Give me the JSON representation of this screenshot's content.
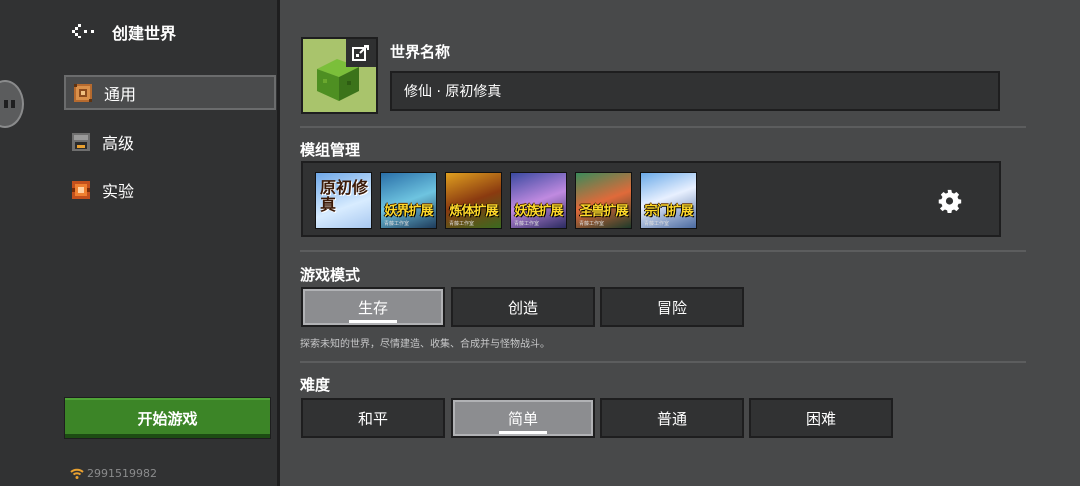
{
  "header": {
    "title": "创建世界"
  },
  "sidebar": {
    "items": [
      {
        "label": "通用",
        "icon": "command-block-icon",
        "active": true
      },
      {
        "label": "高级",
        "icon": "furnace-icon",
        "active": false
      },
      {
        "label": "实验",
        "icon": "experiment-icon",
        "active": false
      }
    ],
    "start_label": "开始游戏",
    "user_id": "2991519982"
  },
  "world": {
    "name_label": "世界名称",
    "name_value": "修仙 · 原初修真"
  },
  "mods": {
    "title": "模组管理",
    "items": [
      {
        "text": "原初修真",
        "sub": ""
      },
      {
        "text": "妖界扩展",
        "sub": "青藤工作室"
      },
      {
        "text": "炼体扩展",
        "sub": "青藤工作室"
      },
      {
        "text": "妖族扩展",
        "sub": "青藤工作室"
      },
      {
        "text": "圣兽扩展",
        "sub": "青藤工作室"
      },
      {
        "text": "宗门扩展",
        "sub": "青藤工作室"
      }
    ]
  },
  "game_mode": {
    "title": "游戏模式",
    "options": [
      "生存",
      "创造",
      "冒险"
    ],
    "selected": "生存",
    "description": "探索未知的世界，尽情建造、收集、合成并与怪物战斗。"
  },
  "difficulty": {
    "title": "难度",
    "options": [
      "和平",
      "简单",
      "普通",
      "困难"
    ],
    "selected": "简单"
  },
  "colors": {
    "accent_green": "#3c8527",
    "panel": "#313233",
    "background": "#48494a"
  }
}
